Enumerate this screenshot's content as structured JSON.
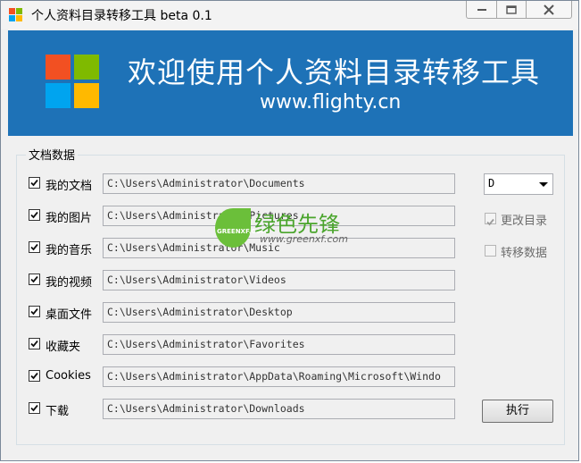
{
  "window": {
    "title": "个人资料目录转移工具 beta 0.1"
  },
  "banner": {
    "title": "欢迎使用个人资料目录转移工具",
    "subtitle": "www.flighty.cn"
  },
  "group": {
    "label": "文档数据"
  },
  "rows": [
    {
      "label": "我的文档",
      "checked": true,
      "path": "C:\\Users\\Administrator\\Documents"
    },
    {
      "label": "我的图片",
      "checked": true,
      "path": "C:\\Users\\Administrator\\Pictures"
    },
    {
      "label": "我的音乐",
      "checked": true,
      "path": "C:\\Users\\Administrator\\Music"
    },
    {
      "label": "我的视频",
      "checked": true,
      "path": "C:\\Users\\Administrator\\Videos"
    },
    {
      "label": "桌面文件",
      "checked": true,
      "path": "C:\\Users\\Administrator\\Desktop"
    },
    {
      "label": "收藏夹",
      "checked": true,
      "path": "C:\\Users\\Administrator\\Favorites"
    },
    {
      "label": "Cookies",
      "checked": true,
      "path": "C:\\Users\\Administrator\\AppData\\Roaming\\Microsoft\\Windo"
    },
    {
      "label": "下载",
      "checked": true,
      "path": "C:\\Users\\Administrator\\Downloads"
    }
  ],
  "drive_select": {
    "value": "D"
  },
  "options": {
    "change_dir": {
      "label": "更改目录",
      "checked": true,
      "disabled": true
    },
    "move_data": {
      "label": "转移数据",
      "checked": false,
      "disabled": true
    }
  },
  "execute_button": {
    "label": "执行"
  },
  "watermark": {
    "text": "绿色先锋",
    "badge": "GREENXF.COM",
    "url": "www.greenxf.com"
  },
  "colors": {
    "banner": "#1e72b7",
    "logo_red": "#f25022",
    "logo_green": "#7fba00",
    "logo_blue": "#00a4ef",
    "logo_yellow": "#ffb900"
  },
  "icons": {
    "app": "windows-logo-icon",
    "minimize": "minimize-icon",
    "maximize": "maximize-icon",
    "close": "close-icon",
    "dropdown": "chevron-down-icon"
  }
}
